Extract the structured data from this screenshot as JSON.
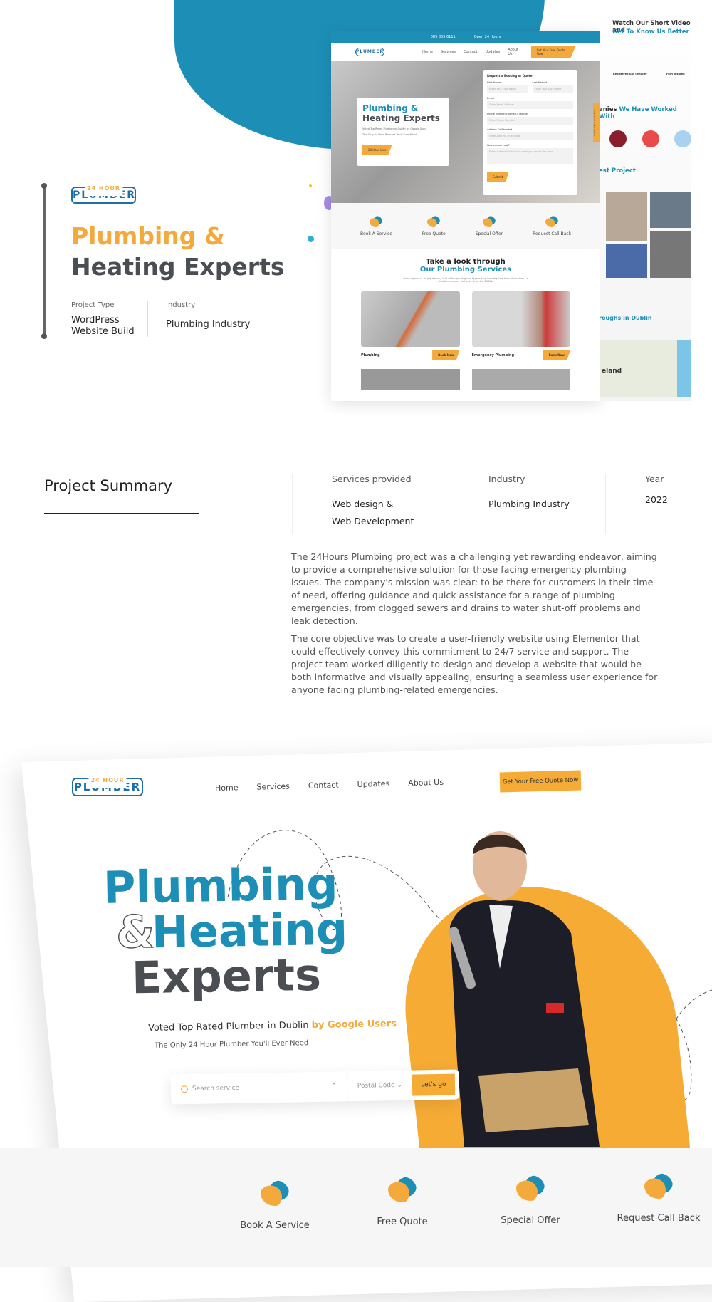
{
  "brand": {
    "logo_top": "24 HOUR",
    "logo_main": "PLUMBER"
  },
  "intro": {
    "title_line1": "Plumbing &",
    "title_line2": "Heating Experts",
    "project_type_label": "Project Type",
    "project_type_value_1": "WordPress",
    "project_type_value_2": "Website Build",
    "industry_label": "Industry",
    "industry_value": "Plumbing Industry"
  },
  "mock": {
    "phone": "085 855 6111",
    "hours": "Open 24 Hours",
    "nav": [
      "Home",
      "Services",
      "Contact",
      "Updates",
      "About Us"
    ],
    "cta": "Get Your Free Quote Now",
    "hero_title_1": "Plumbing &",
    "hero_title_2": "Heating Experts",
    "hero_sub_1": "Voted Top Rated Plumber in Dublin by Google Users",
    "hero_sub_2": "The Only 24 Hour Plumber You'll Ever Need",
    "hero_btn": "24 Hour Live",
    "form": {
      "title": "Request a Booking or Quote",
      "first_name": "First Name*",
      "first_ph": "Enter Your First Name",
      "last_name": "Last Name*",
      "last_ph": "Enter Your Last Name",
      "email": "Email",
      "email_ph": "Enter Email Address",
      "phone": "Phone Number (Home Or Mobile)",
      "phone_ph": "Enter Phone Number",
      "address": "Address Or Eircode*",
      "address_ph": "Enter Address Or Eircode",
      "help": "How can we help?",
      "help_ph": "Enter a description of the work you would like done",
      "submit": "Submit"
    },
    "side_tab": "Get Your Free Quote Now",
    "services": [
      "Book A Service",
      "Free Quote",
      "Special Offer",
      "Request Call Back"
    ],
    "look_1": "Take a look through",
    "look_2": "Our Plumbing Services",
    "look_desc": "Lorem Ipsum is simply dummy text of the printing and typesetting industry. has been the industry's standard dummy text ever since the 1500s.",
    "cards": [
      {
        "name": "Plumbing",
        "btn": "Book Now"
      },
      {
        "name": "Emergency Plumbing",
        "btn": "Book Now"
      }
    ]
  },
  "strip": {
    "video_1": "Watch Our Short Video and",
    "video_2": "Get To Know Us Better",
    "badge_1": "Registered Gas Installer",
    "badge_2": "Fully Insured",
    "companies_a": "anies",
    "companies_b": "We Have Worked With",
    "project": "est Project",
    "dublin": "roughs in Dublin",
    "map_label": "eland"
  },
  "summary": {
    "title": "Project Summary",
    "columns": [
      {
        "label": "Services provided",
        "value_1": "Web design &",
        "value_2": "Web Development"
      },
      {
        "label": "Industry",
        "value_1": "Plumbing Industry"
      },
      {
        "label": "Year",
        "value_1": "2022"
      }
    ],
    "para_1": "The 24Hours Plumbing project was a challenging yet rewarding endeavor, aiming to provide a comprehensive solution for those facing emergency plumbing issues. The company's mission was clear: to be there for customers in their time of need, offering guidance and quick assistance for a range of plumbing emergencies, from clogged sewers and drains to water shut-off problems and leak detection.",
    "para_2": "The core objective was to create a user-friendly website using Elementor that could effectively convey this commitment to 24/7 service and support. The project team worked diligently to design and develop a website that would be both informative and visually appealing, ensuring a seamless user experience for anyone facing plumbing-related emergencies."
  },
  "hero2": {
    "nav": [
      "Home",
      "Services",
      "Contact",
      "Updates",
      "About Us"
    ],
    "cta": "Get Your Free Quote Now",
    "t1": "Plumbing",
    "amp": "&",
    "t2": "Heating",
    "t3": "Experts",
    "voted": "Voted Top Rated Plumber in Dublin ",
    "voted_hl": "by Google Users",
    "sub": "The Only 24 Hour Plumber You'll Ever Need",
    "search_ph": "Search service",
    "postal": "Postal Code",
    "go": "Let's go",
    "services": [
      "Book A Service",
      "Free Quote",
      "Special Offer",
      "Request Call Back"
    ]
  },
  "colors": {
    "blue": "#1d8fb7",
    "orange": "#f4a93c",
    "dark": "#4a4d52"
  }
}
